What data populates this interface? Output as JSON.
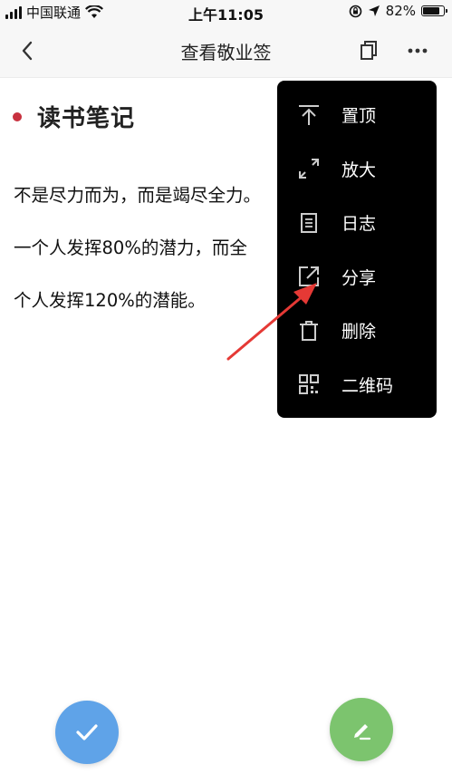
{
  "status_bar": {
    "carrier": "中国联通",
    "time": "上午11:05",
    "battery": "82%",
    "battery_level": 0.82
  },
  "nav": {
    "title": "查看敬业签",
    "back_icon": "chevron-left-icon",
    "copy_icon": "copy-icon",
    "more_icon": "more-horizontal-icon"
  },
  "note": {
    "title": "读书笔记",
    "dot_color": "#c8313f",
    "body_lines": [
      "不是尽力而为，而是竭尽全力。",
      "一个人发挥80%的潜力，而全",
      "个人发挥120%的潜能。"
    ]
  },
  "menu": {
    "items": [
      {
        "label": "置顶",
        "icon": "pin-top-icon"
      },
      {
        "label": "放大",
        "icon": "expand-icon"
      },
      {
        "label": "日志",
        "icon": "log-document-icon"
      },
      {
        "label": "分享",
        "icon": "share-icon"
      },
      {
        "label": "删除",
        "icon": "trash-icon"
      },
      {
        "label": "二维码",
        "icon": "qr-code-icon"
      }
    ]
  },
  "fabs": {
    "confirm_color": "#5fa3e8",
    "edit_color": "#7cc46e",
    "arrow_color": "#e53935"
  }
}
